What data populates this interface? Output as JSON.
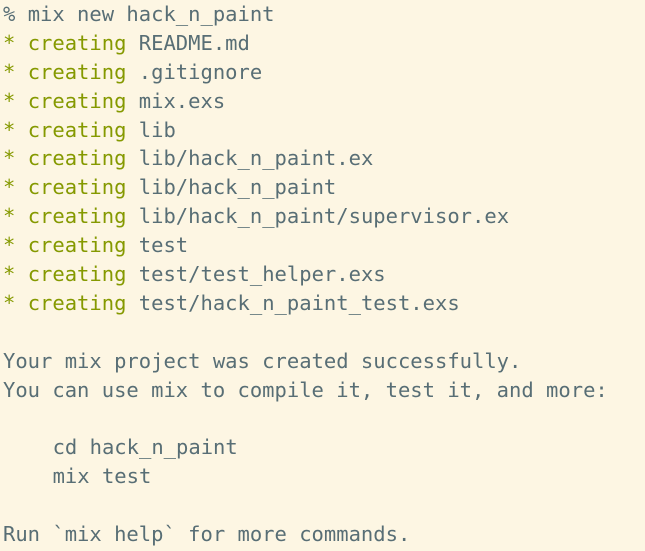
{
  "prompt": {
    "symbol": "%",
    "command": "mix new hack_n_paint"
  },
  "created": {
    "star": "*",
    "verb": "creating",
    "paths": [
      "README.md",
      ".gitignore",
      "mix.exs",
      "lib",
      "lib/hack_n_paint.ex",
      "lib/hack_n_paint",
      "lib/hack_n_paint/supervisor.ex",
      "test",
      "test/test_helper.exs",
      "test/hack_n_paint_test.exs"
    ]
  },
  "message": {
    "success": "Your mix project was created successfully.",
    "hint": "You can use mix to compile it, test it, and more:",
    "commands": [
      "cd hack_n_paint",
      "mix test"
    ],
    "footer": "Run `mix help` for more commands."
  },
  "colors": {
    "background": "#fdf6e3",
    "text": "#586e75",
    "accent": "#859900"
  }
}
